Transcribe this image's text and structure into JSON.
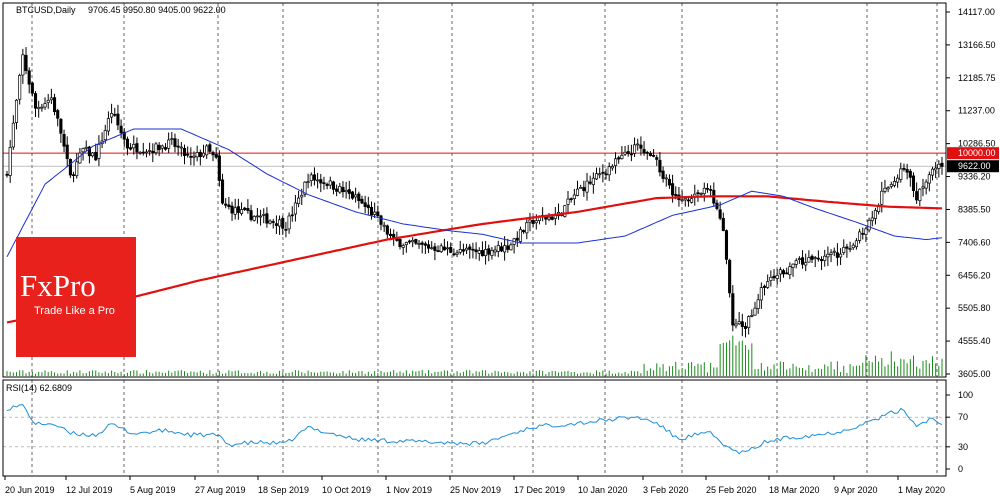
{
  "header": {
    "symbol": "BTCUSD,Daily",
    "ohlc": "9706.45 9950.80 9405.00 9622.00"
  },
  "rsi_header": "RSI(14) 62.6809",
  "logo": {
    "brand": "FxPro",
    "tagline": "Trade Like a Pro"
  },
  "colors": {
    "background": "#ffffff",
    "candle": "#000000",
    "ma_fast": "#1a2fd0",
    "ma_slow": "#e01010",
    "level_line": "#e01010",
    "volume": "#1a8a1a",
    "rsi": "#1e8fd8",
    "last_price_bg": "#000000",
    "level_label_bg": "#e01010",
    "logo_bg": "#e8211d"
  },
  "price_axis": {
    "labels": [
      "14117.00",
      "13166.50",
      "12185.75",
      "11237.00",
      "10286.50",
      "9336.20",
      "8385.50",
      "7406.60",
      "6456.20",
      "5505.80",
      "4555.40",
      "3605.00"
    ],
    "level_label": "10000.00",
    "last_price_label": "9622.00"
  },
  "rsi_axis": {
    "labels": [
      "100",
      "70",
      "30",
      "0"
    ]
  },
  "date_axis": [
    "20 Jun 2019",
    "12 Jul 2019",
    "5 Aug 2019",
    "27 Aug 2019",
    "18 Sep 2019",
    "10 Oct 2019",
    "1 Nov 2019",
    "25 Nov 2019",
    "17 Dec 2019",
    "10 Jan 2020",
    "3 Feb 2020",
    "25 Feb 2020",
    "18 Mar 2020",
    "9 Apr 2020",
    "1 May 2020"
  ],
  "chart_data": {
    "type": "line",
    "title": "BTCUSD,Daily",
    "ylim": [
      3605,
      14117
    ],
    "anchors_close": [
      [
        0,
        9500
      ],
      [
        5,
        12800
      ],
      [
        9,
        11300
      ],
      [
        14,
        11600
      ],
      [
        17,
        10600
      ],
      [
        20,
        9300
      ],
      [
        24,
        10100
      ],
      [
        28,
        9900
      ],
      [
        33,
        11200
      ],
      [
        38,
        10200
      ],
      [
        45,
        10100
      ],
      [
        52,
        10300
      ],
      [
        58,
        9800
      ],
      [
        63,
        10100
      ],
      [
        66,
        9800
      ],
      [
        68,
        8500
      ],
      [
        73,
        8300
      ],
      [
        79,
        8150
      ],
      [
        86,
        8000
      ],
      [
        88,
        7900
      ],
      [
        92,
        8650
      ],
      [
        95,
        9300
      ],
      [
        101,
        9150
      ],
      [
        110,
        8700
      ],
      [
        116,
        8200
      ],
      [
        122,
        7450
      ],
      [
        128,
        7350
      ],
      [
        136,
        7250
      ],
      [
        142,
        7150
      ],
      [
        150,
        7150
      ],
      [
        158,
        7300
      ],
      [
        166,
        8050
      ],
      [
        174,
        8200
      ],
      [
        180,
        8900
      ],
      [
        186,
        9300
      ],
      [
        193,
        9800
      ],
      [
        199,
        10200
      ],
      [
        205,
        9700
      ],
      [
        212,
        8600
      ],
      [
        217,
        8800
      ],
      [
        222,
        8950
      ],
      [
        226,
        7750
      ],
      [
        229,
        5100
      ],
      [
        233,
        5000
      ],
      [
        239,
        6200
      ],
      [
        246,
        6650
      ],
      [
        252,
        6900
      ],
      [
        259,
        7000
      ],
      [
        264,
        7150
      ],
      [
        268,
        7550
      ],
      [
        272,
        8000
      ],
      [
        276,
        8800
      ],
      [
        279,
        9100
      ],
      [
        283,
        9600
      ],
      [
        287,
        8750
      ],
      [
        291,
        9350
      ],
      [
        295,
        9622
      ]
    ],
    "anchors_ma50": [
      [
        0,
        7000
      ],
      [
        12,
        9100
      ],
      [
        27,
        10200
      ],
      [
        40,
        10700
      ],
      [
        55,
        10700
      ],
      [
        70,
        10100
      ],
      [
        82,
        9400
      ],
      [
        95,
        8800
      ],
      [
        110,
        8300
      ],
      [
        125,
        7950
      ],
      [
        140,
        7750
      ],
      [
        150,
        7650
      ],
      [
        162,
        7400
      ],
      [
        180,
        7400
      ],
      [
        195,
        7600
      ],
      [
        210,
        8200
      ],
      [
        225,
        8500
      ],
      [
        235,
        8900
      ],
      [
        245,
        8750
      ],
      [
        255,
        8400
      ],
      [
        268,
        8000
      ],
      [
        280,
        7600
      ],
      [
        290,
        7500
      ],
      [
        295,
        7550
      ]
    ],
    "anchors_ma200": [
      [
        0,
        5100
      ],
      [
        30,
        5600
      ],
      [
        60,
        6300
      ],
      [
        90,
        6900
      ],
      [
        120,
        7500
      ],
      [
        150,
        7950
      ],
      [
        180,
        8300
      ],
      [
        205,
        8700
      ],
      [
        222,
        8750
      ],
      [
        240,
        8750
      ],
      [
        258,
        8600
      ],
      [
        278,
        8450
      ],
      [
        295,
        8400
      ]
    ],
    "rsi_anchors": [
      [
        0,
        82
      ],
      [
        5,
        86
      ],
      [
        9,
        60
      ],
      [
        14,
        62
      ],
      [
        20,
        48
      ],
      [
        28,
        46
      ],
      [
        33,
        60
      ],
      [
        40,
        48
      ],
      [
        50,
        52
      ],
      [
        58,
        46
      ],
      [
        66,
        46
      ],
      [
        70,
        33
      ],
      [
        79,
        36
      ],
      [
        88,
        34
      ],
      [
        95,
        56
      ],
      [
        110,
        40
      ],
      [
        122,
        38
      ],
      [
        136,
        36
      ],
      [
        150,
        34
      ],
      [
        158,
        46
      ],
      [
        166,
        57
      ],
      [
        180,
        62
      ],
      [
        193,
        68
      ],
      [
        199,
        70
      ],
      [
        205,
        62
      ],
      [
        212,
        40
      ],
      [
        217,
        46
      ],
      [
        222,
        48
      ],
      [
        229,
        24
      ],
      [
        233,
        22
      ],
      [
        239,
        36
      ],
      [
        246,
        42
      ],
      [
        259,
        48
      ],
      [
        264,
        52
      ],
      [
        276,
        70
      ],
      [
        279,
        76
      ],
      [
        283,
        80
      ],
      [
        287,
        58
      ],
      [
        291,
        68
      ],
      [
        295,
        62.7
      ]
    ],
    "level_line": 10000,
    "rsi_levels": [
      70,
      30
    ]
  }
}
